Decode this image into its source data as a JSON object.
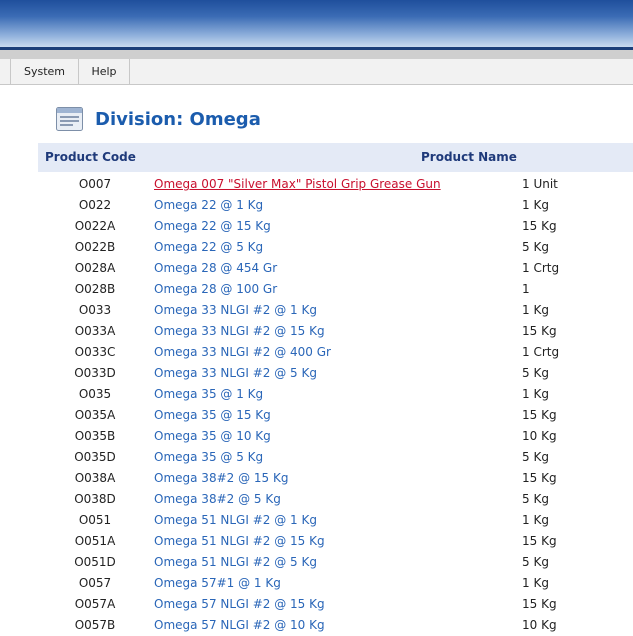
{
  "menu": {
    "items": [
      {
        "label": "System"
      },
      {
        "label": "Help"
      }
    ]
  },
  "page": {
    "heading": "Division: Omega",
    "icon": "document-list-icon"
  },
  "table": {
    "columns": [
      "Product Code",
      "Product Name"
    ],
    "rows": [
      {
        "code": "O007",
        "name": "Omega 007 \"Silver Max\" Pistol Grip Grease Gun",
        "unit": "1 Unit",
        "active": true
      },
      {
        "code": "O022",
        "name": "Omega 22 @ 1 Kg",
        "unit": "1 Kg"
      },
      {
        "code": "O022A",
        "name": "Omega 22 @ 15 Kg",
        "unit": "15 Kg"
      },
      {
        "code": "O022B",
        "name": "Omega 22 @ 5 Kg",
        "unit": "5 Kg"
      },
      {
        "code": "O028A",
        "name": "Omega 28 @ 454 Gr",
        "unit": "1 Crtg"
      },
      {
        "code": "O028B",
        "name": "Omega 28 @ 100 Gr",
        "unit": "1"
      },
      {
        "code": "O033",
        "name": "Omega 33 NLGI #2 @ 1 Kg",
        "unit": "1 Kg"
      },
      {
        "code": "O033A",
        "name": "Omega 33 NLGI #2 @ 15 Kg",
        "unit": "15 Kg"
      },
      {
        "code": "O033C",
        "name": "Omega 33 NLGI #2 @ 400 Gr",
        "unit": "1 Crtg"
      },
      {
        "code": "O033D",
        "name": "Omega 33 NLGI #2 @ 5 Kg",
        "unit": "5 Kg"
      },
      {
        "code": "O035",
        "name": "Omega 35 @ 1 Kg",
        "unit": "1 Kg"
      },
      {
        "code": "O035A",
        "name": "Omega 35 @ 15 Kg",
        "unit": "15 Kg"
      },
      {
        "code": "O035B",
        "name": "Omega 35 @ 10 Kg",
        "unit": "10 Kg"
      },
      {
        "code": "O035D",
        "name": "Omega 35 @ 5 Kg",
        "unit": "5 Kg"
      },
      {
        "code": "O038A",
        "name": "Omega 38#2 @ 15 Kg",
        "unit": "15 Kg"
      },
      {
        "code": "O038D",
        "name": "Omega 38#2 @ 5 Kg",
        "unit": "5 Kg"
      },
      {
        "code": "O051",
        "name": "Omega 51 NLGI #2 @ 1 Kg",
        "unit": "1 Kg"
      },
      {
        "code": "O051A",
        "name": "Omega 51 NLGI #2 @ 15 Kg",
        "unit": "15 Kg"
      },
      {
        "code": "O051D",
        "name": "Omega 51 NLGI #2 @ 5 Kg",
        "unit": "5 Kg"
      },
      {
        "code": "O057",
        "name": "Omega 57#1 @ 1 Kg",
        "unit": "1 Kg"
      },
      {
        "code": "O057A",
        "name": "Omega 57 NLGI #2 @ 15 Kg",
        "unit": "15 Kg"
      },
      {
        "code": "O057B",
        "name": "Omega 57 NLGI #2 @ 10 Kg",
        "unit": "10 Kg"
      }
    ]
  }
}
